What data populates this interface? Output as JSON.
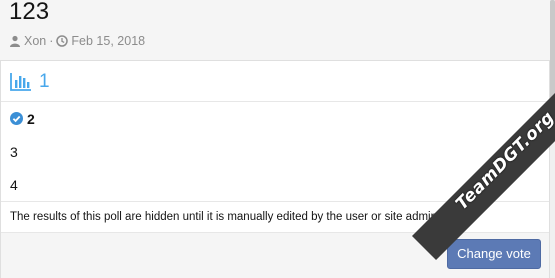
{
  "thread": {
    "title": "123",
    "author": "Xon",
    "separator": "·",
    "date": "Feb 15, 2018",
    "author_icon": "user-icon",
    "date_icon": "clock-icon"
  },
  "poll": {
    "icon": "bar-chart-icon",
    "title": "1",
    "responses": [
      {
        "label": "2",
        "voted": true
      },
      {
        "label": "3",
        "voted": false
      },
      {
        "label": "4",
        "voted": false
      }
    ],
    "notice": "The results of this poll are hidden until it is manually edited by the user or site admin.",
    "change_vote_label": "Change vote"
  },
  "watermark": {
    "text": "TeamDGT.org"
  },
  "colors": {
    "accent": "#47a7eb",
    "button": "#5c7ab5",
    "meta_text": "#8c8c8c"
  }
}
